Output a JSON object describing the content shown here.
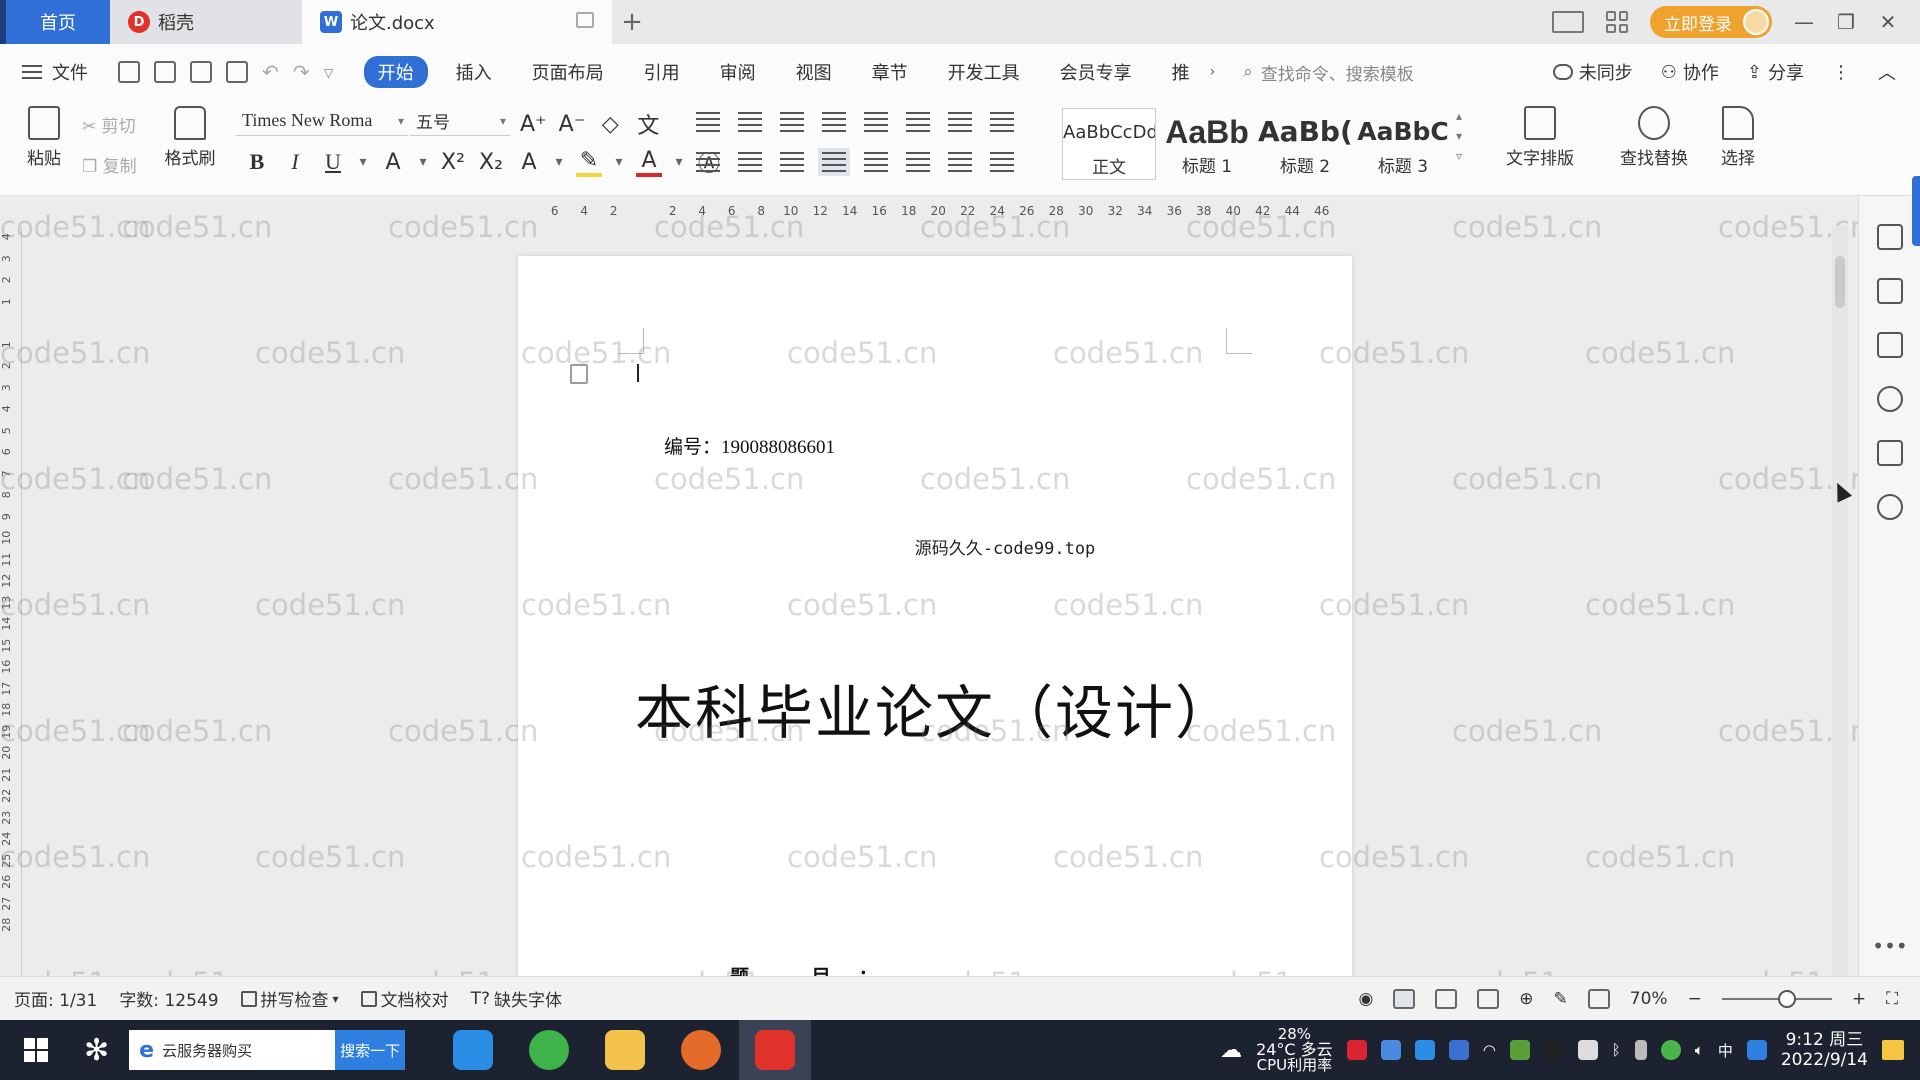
{
  "tabs": {
    "home": "首页",
    "docer": "稻壳",
    "doc": "论文.docx",
    "login": "立即登录"
  },
  "menu": {
    "file": "文件",
    "items": [
      "开始",
      "插入",
      "页面布局",
      "引用",
      "审阅",
      "视图",
      "章节",
      "开发工具",
      "会员专享",
      "推"
    ],
    "active": "开始",
    "search_cmd": "查找命令、搜索模板",
    "sync": "未同步",
    "collab": "协作",
    "share": "分享"
  },
  "ribbon": {
    "paste": "粘贴",
    "cut": "剪切",
    "copy": "复制",
    "format_painter": "格式刷",
    "font_name": "Times New Roma",
    "font_size": "五号",
    "styles": [
      {
        "preview": "AaBbCcDd",
        "label": "正文"
      },
      {
        "preview": "AaBb",
        "label": "标题 1"
      },
      {
        "preview": "AaBb(",
        "label": "标题 2"
      },
      {
        "preview": "AaBbC",
        "label": "标题 3"
      }
    ],
    "text_layout": "文字排版",
    "find_replace": "查找替换",
    "select": "选择"
  },
  "ruler": {
    "top": [
      "6",
      "4",
      "2",
      "",
      "2",
      "4",
      "6",
      "8",
      "10",
      "12",
      "14",
      "16",
      "18",
      "20",
      "22",
      "24",
      "26",
      "28",
      "30",
      "32",
      "34",
      "36",
      "38",
      "40",
      "42",
      "44",
      "46"
    ],
    "left": [
      "4",
      "3",
      "2",
      "1",
      "",
      "1",
      "2",
      "3",
      "4",
      "5",
      "6",
      "7",
      "8",
      "9",
      "10",
      "11",
      "12",
      "13",
      "14",
      "15",
      "16",
      "17",
      "18",
      "19",
      "20",
      "21",
      "22",
      "23",
      "24",
      "25",
      "26",
      "27",
      "28"
    ]
  },
  "document": {
    "number": "编号：190088086601",
    "source": "源码久久-code99.top",
    "title": "本科毕业论文（设计）",
    "field_label": "题 目："
  },
  "watermark": "code51.cn",
  "status": {
    "page": "页面: 1/31",
    "words": "字数: 12549",
    "spell": "拼写检查",
    "proof": "文档校对",
    "missing_font": "缺失字体",
    "zoom": "70%"
  },
  "taskbar": {
    "search_text": "云服务器购买",
    "search_btn": "搜索一下",
    "weather_temp": "24°C 多云",
    "cpu": "28%",
    "cpu_label": "CPU利用率",
    "ime": "中",
    "time": "9:12 周三",
    "date": "2022/9/14"
  }
}
